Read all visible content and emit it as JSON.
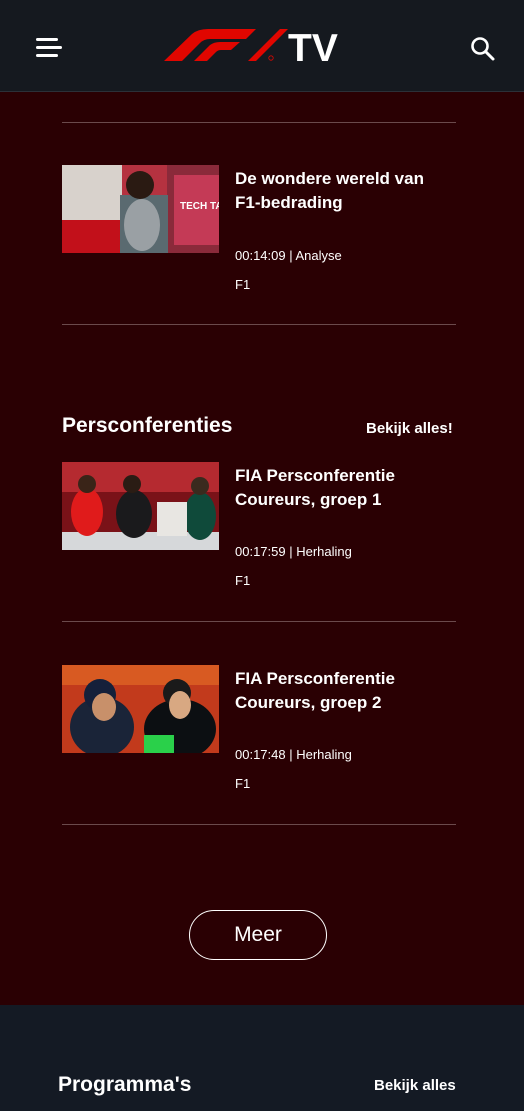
{
  "header": {
    "logo_text": "F1",
    "logo_suffix": "TV",
    "menu_icon": "hamburger-menu-icon",
    "search_icon": "search-icon"
  },
  "videos_top": [
    {
      "title": "De wondere wereld van F1-bedrading",
      "meta": "00:14:09 | Analyse",
      "tag": "F1",
      "thumb_text": "TECH TALK"
    }
  ],
  "press": {
    "title": "Persconferenties",
    "see_all": "Bekijk alles!",
    "items": [
      {
        "title": "FIA Persconferentie Coureurs, groep 1",
        "meta": "00:17:59 | Herhaling",
        "tag": "F1"
      },
      {
        "title": "FIA Persconferentie Coureurs, groep 2",
        "meta": "00:17:48 | Herhaling",
        "tag": "F1"
      }
    ]
  },
  "more_label": "Meer",
  "programs": {
    "title": "Programma's",
    "see_all": "Bekijk alles"
  },
  "colors": {
    "header_bg": "#15191f",
    "section_bg": "#2a0003",
    "footer_bg": "#141a24",
    "accent": "#e10600"
  }
}
